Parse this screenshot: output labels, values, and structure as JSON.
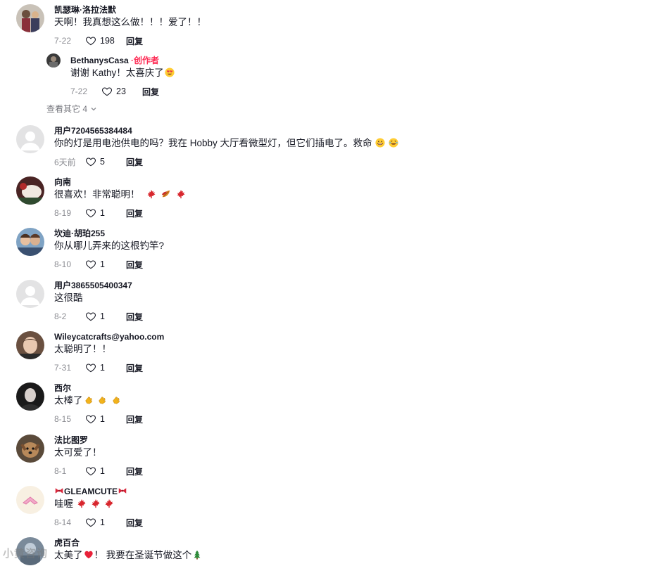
{
  "comments": [
    {
      "name": "凯瑟琳·洛拉法默",
      "text": "天啊！我真想这么做！！！爱了！！",
      "date": "7-22",
      "likes": "198",
      "reply": "回复"
    },
    {
      "name": "BethanysCasa",
      "badge": " ·创作者",
      "text": "谢谢 Kathy！太喜庆了",
      "date": "7-22",
      "likes": "23",
      "reply": "回复"
    },
    {
      "name": "用户7204565384484",
      "text": "你的灯是用电池供电的吗？我在 Hobby 大厅看微型灯，但它们插电了。救命",
      "date": "6天前",
      "likes": "5",
      "reply": "回复"
    },
    {
      "name": "向南",
      "text": "很喜欢！非常聪明！",
      "date": "8-19",
      "likes": "1",
      "reply": "回复"
    },
    {
      "name": "坎迪·胡珀255",
      "text": "你从哪儿弄来的这根钓竿?",
      "date": "8-10",
      "likes": "1",
      "reply": "回复"
    },
    {
      "name": "用户3865505400347",
      "text": "这很酷",
      "date": "8-2",
      "likes": "1",
      "reply": "回复"
    },
    {
      "name": "Wileycatcrafts@yahoo.com",
      "text": "太聪明了！！",
      "date": "7-31",
      "likes": "1",
      "reply": "回复"
    },
    {
      "name": "西尔",
      "text": "太棒了",
      "date": "8-15",
      "likes": "1",
      "reply": "回复"
    },
    {
      "name": "法比图罗",
      "text": "太可爱了！",
      "date": "8-1",
      "likes": "1",
      "reply": "回复"
    },
    {
      "name": "GLEAMCUTE",
      "text": "哇喔",
      "date": "8-14",
      "likes": "1",
      "reply": "回复"
    },
    {
      "name": "虎百合",
      "text": "太美了",
      "text2": "！ 我要在圣诞节做这个"
    }
  ],
  "view_more": "查看其它 4",
  "watermark": "小黄咨询",
  "colors": {
    "accent": "#fe2c55",
    "text": "#161823",
    "muted": "#8a8b91"
  },
  "icons": [
    "heart-icon",
    "chevron-down-icon",
    "maple-leaf-emoji",
    "clap-emoji",
    "heart-eyes-emoji",
    "grin-emoji",
    "bow-emoji",
    "christmas-tree-emoji"
  ]
}
